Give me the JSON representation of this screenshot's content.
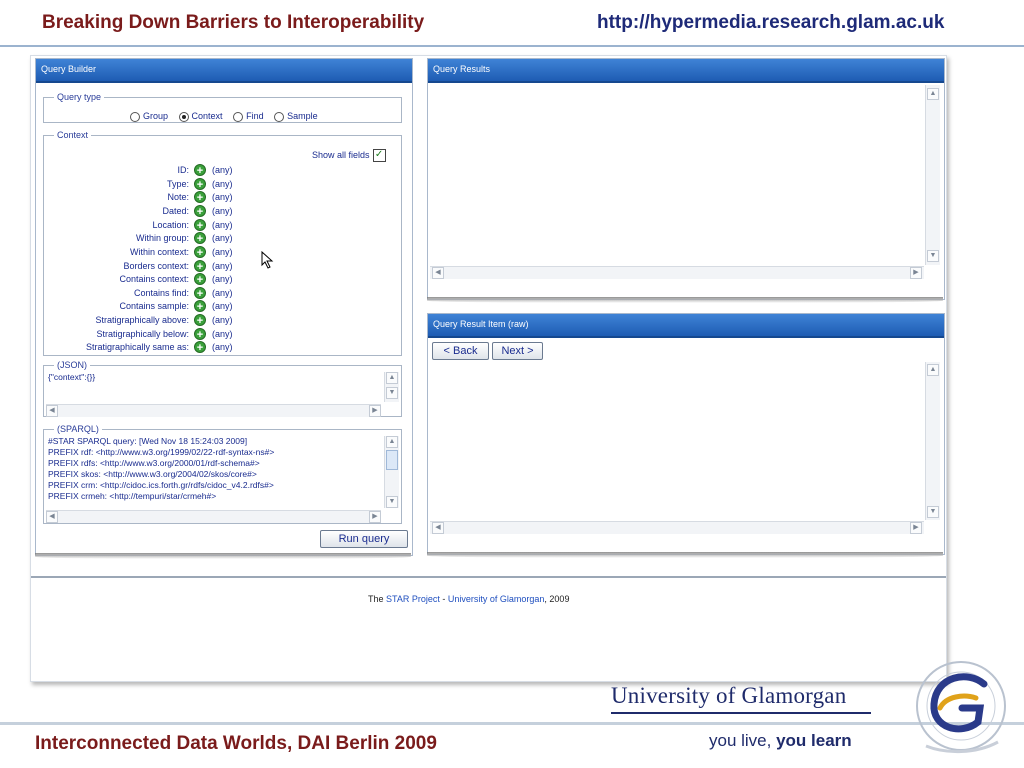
{
  "slide": {
    "title": "Breaking Down Barriers to Interoperability",
    "url": "http://hypermedia.research.glam.ac.uk",
    "conference": "Interconnected Data Worlds, DAI Berlin 2009"
  },
  "query_builder": {
    "header": "Query Builder",
    "query_type": {
      "legend": "Query type",
      "options": [
        "Group",
        "Context",
        "Find",
        "Sample"
      ],
      "selected": "Context"
    },
    "context": {
      "legend": "Context",
      "show_all_fields": "Show all fields",
      "show_all_checked": true,
      "fields": [
        {
          "label": "ID:",
          "value": "(any)"
        },
        {
          "label": "Type:",
          "value": "(any)"
        },
        {
          "label": "Note:",
          "value": "(any)"
        },
        {
          "label": "Dated:",
          "value": "(any)"
        },
        {
          "label": "Location:",
          "value": "(any)"
        },
        {
          "label": "Within group:",
          "value": "(any)"
        },
        {
          "label": "Within context:",
          "value": "(any)"
        },
        {
          "label": "Borders context:",
          "value": "(any)"
        },
        {
          "label": "Contains context:",
          "value": "(any)"
        },
        {
          "label": "Contains find:",
          "value": "(any)"
        },
        {
          "label": "Contains sample:",
          "value": "(any)"
        },
        {
          "label": "Stratigraphically above:",
          "value": "(any)"
        },
        {
          "label": "Stratigraphically below:",
          "value": "(any)"
        },
        {
          "label": "Stratigraphically same as:",
          "value": "(any)"
        }
      ]
    },
    "json": {
      "legend": "(JSON)",
      "value": "{\"context\":{}}"
    },
    "sparql": {
      "legend": "(SPARQL)",
      "lines": [
        "#STAR SPARQL query: [Wed Nov 18 15:24:03 2009]",
        "PREFIX rdf: <http://www.w3.org/1999/02/22-rdf-syntax-ns#>",
        "PREFIX rdfs: <http://www.w3.org/2000/01/rdf-schema#>",
        "PREFIX skos: <http://www.w3.org/2004/02/skos/core#>",
        "PREFIX crm: <http://cidoc.ics.forth.gr/rdfs/cidoc_v4.2.rdfs#>",
        "PREFIX crmeh: <http://tempuri/star/crmeh#>"
      ]
    },
    "run_button": "Run query"
  },
  "query_results": {
    "header": "Query Results"
  },
  "query_result_item": {
    "header": "Query Result Item (raw)",
    "back_button": "< Back",
    "next_button": "Next >"
  },
  "footer": {
    "prefix": "The ",
    "project_link": "STAR Project",
    "separator": " - ",
    "university_link": "University of Glamorgan",
    "suffix": ", 2009"
  },
  "branding": {
    "university_name": "University of Glamorgan",
    "tagline_part1": "you live, ",
    "tagline_part2": "you learn"
  },
  "colors": {
    "header_blue": "#1e5cb3",
    "title_red": "#7a1b1b",
    "link_blue": "#1f4fbf",
    "plus_green": "#3aa03a"
  }
}
